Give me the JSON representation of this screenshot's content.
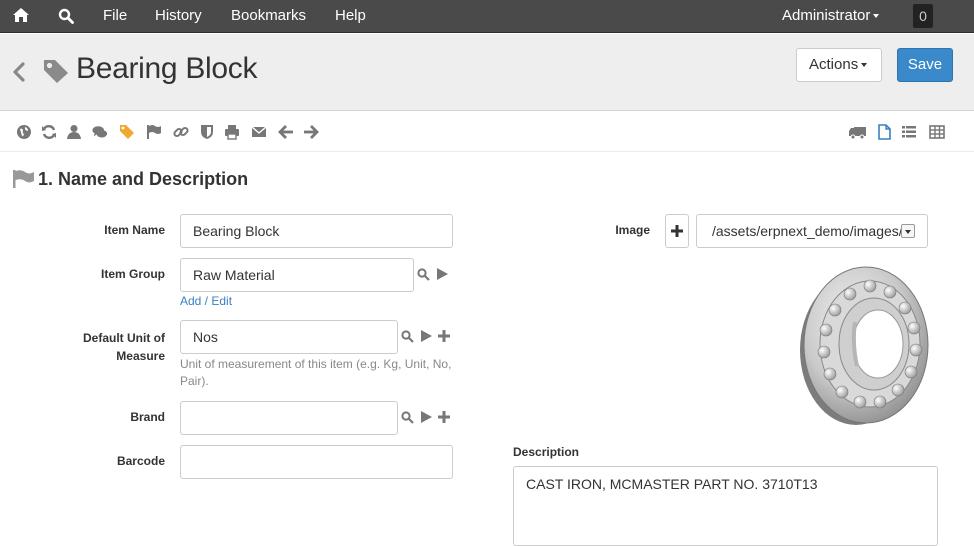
{
  "nav": {
    "file": "File",
    "history": "History",
    "bookmarks": "Bookmarks",
    "help": "Help",
    "user": "Administrator",
    "notifications": "0"
  },
  "header": {
    "title": "Bearing Block",
    "actions_label": "Actions",
    "save_label": "Save"
  },
  "section": {
    "title": "1. Name and Description"
  },
  "fields": {
    "item_name": {
      "label": "Item Name",
      "value": "Bearing Block"
    },
    "item_group": {
      "label": "Item Group",
      "value": "Raw Material",
      "link": "Add / Edit"
    },
    "uom": {
      "label_line1": "Default Unit of",
      "label_line2": "Measure",
      "value": "Nos",
      "help_line1": "Unit of measurement of this item (e.g. Kg, Unit, No,",
      "help_line2": "Pair)."
    },
    "brand": {
      "label": "Brand",
      "value": ""
    },
    "barcode": {
      "label": "Barcode",
      "value": ""
    },
    "image": {
      "label": "Image",
      "value": "/assets/erpnext_demo/images/"
    },
    "description": {
      "label": "Description",
      "value": "CAST IRON, MCMASTER PART NO. 3710T13"
    }
  },
  "colors": {
    "navbar": "#4a4a4a",
    "save_button": "#3a8acb",
    "link": "#3a7fc4",
    "tag_icon": "#888888",
    "active_toolbar_icon": "#f0a830"
  }
}
